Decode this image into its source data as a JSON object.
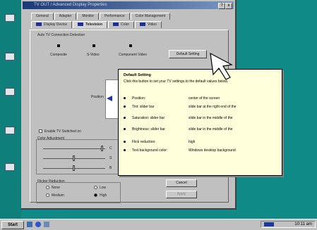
{
  "window": {
    "title": "TV OUT / Advanced Display Properties",
    "close_label": "x",
    "help_label": "?"
  },
  "tabs_row1": [
    "General",
    "Adapter",
    "Monitor",
    "Performance",
    "Color Management"
  ],
  "tabs_row2": [
    "Display Device",
    "Television",
    "Color",
    "Video"
  ],
  "pane": {
    "detect_label": "Auto TV Connection Detection",
    "connectors": [
      "Composite",
      "S-Video",
      "Component Video"
    ],
    "default_button": "Default Setting",
    "position_label": "Position",
    "enable_tv_label": "Enable TV Switched on",
    "color_adjust_label": "Color Adjustment",
    "slider_labels": [
      "C",
      "S",
      "B"
    ],
    "flicker_label": "Flicker Reduction",
    "flicker_options": [
      "None",
      "Low",
      "Medium",
      "High"
    ],
    "cancel_button": "Cancel",
    "apply_button": "Apply"
  },
  "tooltip": {
    "title": "Default Setting",
    "intro": "Click this button to set your TV settings to the default values below.",
    "rows": [
      {
        "name": "Position:",
        "value": "center of the screen"
      },
      {
        "name": "Tint: slider bar",
        "value": "slide bar at the right end of the"
      },
      {
        "name": "Saturation: slider bar",
        "value": "slide bar in the middle of the"
      },
      {
        "name": "Brightness: slider bar",
        "value": "slide bar in the middle of the"
      },
      {
        "name": "Flick reduction:",
        "value": "high"
      },
      {
        "name": "Text background color:",
        "value": "Windows desktop background"
      }
    ]
  },
  "taskbar": {
    "start_label": "Start",
    "clock": "10:11 am"
  },
  "colors": {
    "desktop": "#0f8a86",
    "tooltip_bg": "#ffffdc",
    "titlebar": "#1a3a78"
  }
}
